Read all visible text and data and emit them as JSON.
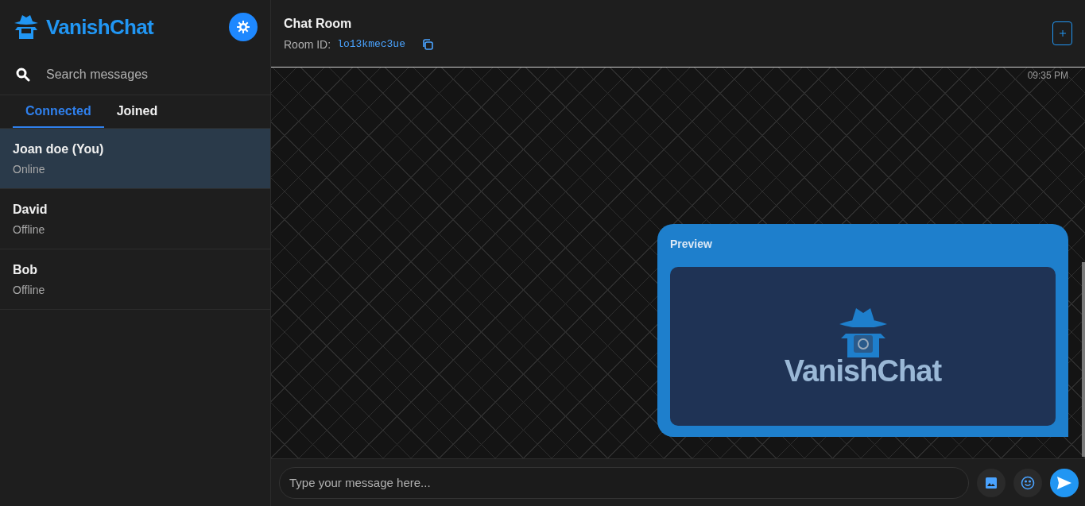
{
  "app": {
    "name": "VanishChat"
  },
  "search": {
    "placeholder": "Search messages"
  },
  "tabs": [
    {
      "label": "Connected",
      "selected": true
    },
    {
      "label": "Joined",
      "selected": false
    }
  ],
  "contacts": [
    {
      "name": "Joan doe (You)",
      "status": "Online",
      "selected": true
    },
    {
      "name": "David",
      "status": "Offline",
      "selected": false
    },
    {
      "name": "Bob",
      "status": "Offline",
      "selected": false
    }
  ],
  "chat": {
    "title": "Chat Room",
    "room_id_label": "Room ID:",
    "room_id": "lo13kmec3ue"
  },
  "messages": [
    {
      "time": "09:35 PM",
      "title": "Preview",
      "image_caption": "VanishChat"
    }
  ],
  "composer": {
    "placeholder": "Type your message here..."
  }
}
